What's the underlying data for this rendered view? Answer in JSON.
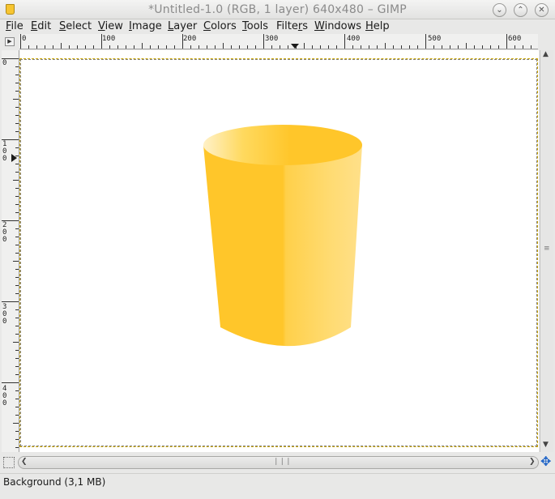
{
  "window": {
    "title": "*Untitled-1.0 (RGB, 1 layer) 640x480 – GIMP",
    "controls": [
      "minimize",
      "maximize",
      "close"
    ]
  },
  "menubar": {
    "items": [
      {
        "label": "File",
        "mnemonic": "F",
        "rest": "ile"
      },
      {
        "label": "Edit",
        "mnemonic": "E",
        "rest": "dit"
      },
      {
        "label": "Select",
        "mnemonic": "S",
        "rest": "elect"
      },
      {
        "label": "View",
        "mnemonic": "V",
        "rest": "iew"
      },
      {
        "label": "Image",
        "mnemonic": "I",
        "rest": "mage"
      },
      {
        "label": "Layer",
        "mnemonic": "L",
        "rest": "ayer"
      },
      {
        "label": "Colors",
        "mnemonic": "C",
        "rest": "olors"
      },
      {
        "label": "Tools",
        "mnemonic": "T",
        "rest": "ools"
      },
      {
        "label": "Filters",
        "prefix": "Filte",
        "mnemonic": "r",
        "rest": "s"
      },
      {
        "label": "Windows",
        "mnemonic": "W",
        "rest": "indows"
      },
      {
        "label": "Help",
        "mnemonic": "H",
        "rest": "elp"
      }
    ]
  },
  "rulers": {
    "horizontal_labels": [
      "0",
      "100",
      "200",
      "300",
      "400",
      "500",
      "600"
    ],
    "vertical_labels": [
      "0",
      "100",
      "200",
      "300",
      "400"
    ]
  },
  "canvas": {
    "image_width": 640,
    "image_height": 480,
    "background_color": "#ffffff",
    "object": "yellow cup",
    "cup_colors": {
      "base": "#ffc62a",
      "highlight": "#ffe08a",
      "rim_light": "#ffe9a8"
    }
  },
  "navigation": {
    "icon": "navigate-icon"
  },
  "status": {
    "layer_info": "Background (3,1 MB)"
  },
  "colors": {
    "accent": "#1f64c8",
    "selection_dash": "#c9a400"
  }
}
